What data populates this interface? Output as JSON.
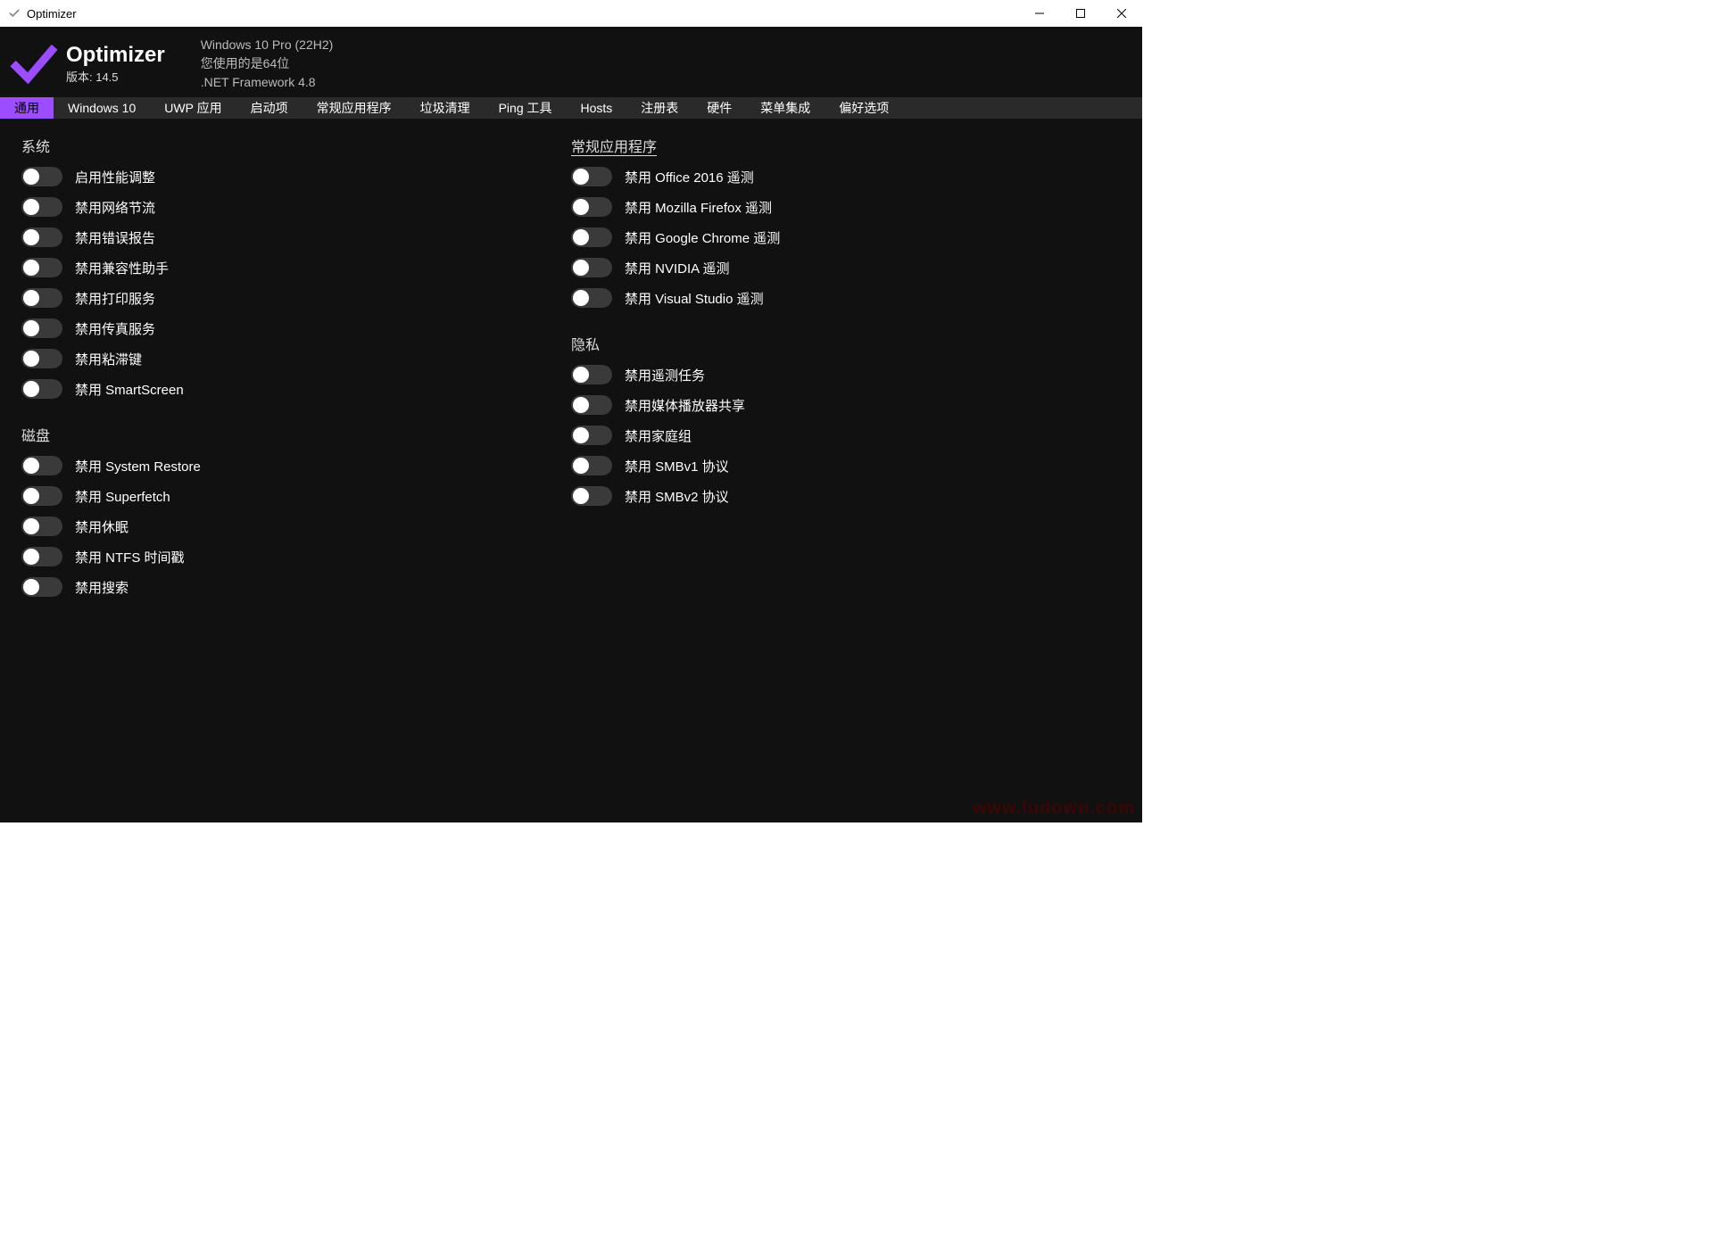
{
  "window": {
    "title": "Optimizer"
  },
  "header": {
    "app_name": "Optimizer",
    "version": "版本: 14.5",
    "os": "Windows 10 Pro (22H2)",
    "arch": "您使用的是64位",
    "dotnet": ".NET Framework 4.8"
  },
  "tabs": [
    "通用",
    "Windows 10",
    "UWP 应用",
    "启动项",
    "常规应用程序",
    "垃圾清理",
    "Ping 工具",
    "Hosts",
    "注册表",
    "硬件",
    "菜单集成",
    "偏好选项"
  ],
  "left": {
    "system_title": "系统",
    "system": [
      "启用性能调整",
      "禁用网络节流",
      "禁用错误报告",
      "禁用兼容性助手",
      "禁用打印服务",
      "禁用传真服务",
      "禁用粘滞键",
      "禁用 SmartScreen"
    ],
    "disk_title": "磁盘",
    "disk": [
      "禁用 System Restore",
      "禁用 Superfetch",
      "禁用休眠",
      "禁用 NTFS 时间戳",
      "禁用搜索"
    ]
  },
  "right": {
    "apps_title": "常规应用程序",
    "apps": [
      "禁用 Office 2016 遥测",
      "禁用 Mozilla Firefox 遥测",
      "禁用 Google Chrome 遥测",
      "禁用 NVIDIA 遥测",
      "禁用 Visual Studio 遥测"
    ],
    "privacy_title": "隐私",
    "privacy": [
      "禁用遥测任务",
      "禁用媒体播放器共享",
      "禁用家庭组",
      "禁用 SMBv1 协议",
      "禁用 SMBv2 协议"
    ]
  },
  "watermark": "www.ludown.com"
}
